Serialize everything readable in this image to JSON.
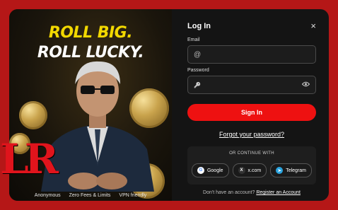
{
  "promo": {
    "headline_line1": "ROLL BIG.",
    "headline_line2": "ROLL LUCKY.",
    "features": [
      "Anonymous",
      "Zero Fees & Limits",
      "VPN friendly"
    ],
    "logo_text": "LR"
  },
  "login": {
    "title": "Log In",
    "close_icon": "×",
    "email_label": "Email",
    "email_prefix": "@",
    "password_label": "Password",
    "password_prefix": "🔑",
    "sign_in_label": "Sign In",
    "forgot_label": "Forgot your password?",
    "continue_with": "OR CONTINUE WITH",
    "socials": [
      {
        "label": "Google",
        "icon": "G"
      },
      {
        "label": "x.com",
        "icon": "X"
      },
      {
        "label": "Telegram",
        "icon": "➤"
      }
    ],
    "no_account_text": "Don't have an account?",
    "register_label": "Register an Account"
  },
  "colors": {
    "accent": "#ee1111",
    "headline_yellow": "#f2d800",
    "frame_red": "#b51717"
  }
}
